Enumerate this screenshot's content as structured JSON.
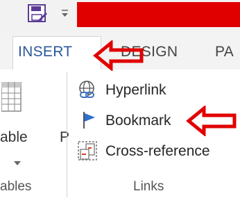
{
  "quick_access": {
    "save_icon": "save-icon",
    "dropdown_icon": "qat-dropdown-icon"
  },
  "tabs": {
    "insert": "INSERT",
    "design": "DESIGN",
    "next": "PA"
  },
  "ribbon": {
    "tables_group": {
      "button_label": "able",
      "group_label": "ables",
      "icon": "table-icon"
    },
    "stub_label": "P",
    "links_group": {
      "items": [
        {
          "label": "Hyperlink",
          "icon": "hyperlink-icon"
        },
        {
          "label": "Bookmark",
          "icon": "bookmark-icon"
        },
        {
          "label": "Cross-reference",
          "icon": "cross-reference-icon"
        }
      ],
      "group_label": "Links"
    }
  },
  "annotations": {
    "arrow_color": "#e00000",
    "redaction_color": "#e00000"
  }
}
